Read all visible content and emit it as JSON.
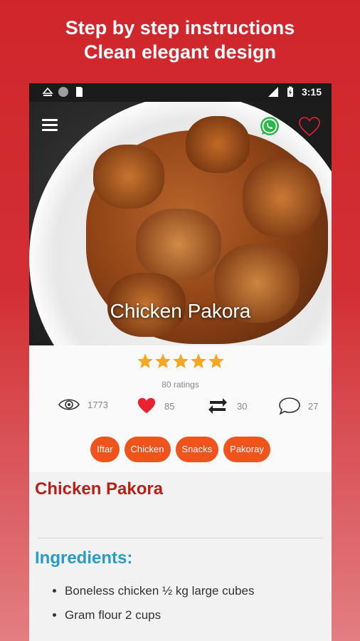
{
  "promo": {
    "line1": "Step by step instructions",
    "line2": "Clean elegant design"
  },
  "statusbar": {
    "time": "3:15",
    "icons": [
      "eject-icon",
      "circle-icon",
      "sd-card-icon",
      "signal-off-icon",
      "battery-icon"
    ]
  },
  "hero": {
    "title": "Chicken Pakora",
    "menu_icon": "hamburger-menu-icon",
    "share_icon": "whatsapp-icon",
    "favorite_icon": "heart-outline-icon"
  },
  "rating": {
    "stars": 5,
    "ratings_text": "80 ratings",
    "star_color": "#f5a623"
  },
  "stats": {
    "views": "1773",
    "likes": "85",
    "shares": "30",
    "comments": "27"
  },
  "tags": [
    "Iftar",
    "Chicken",
    "Snacks",
    "Pakoray"
  ],
  "recipe": {
    "title": "Chicken Pakora",
    "ingredients_heading": "Ingredients:",
    "ingredients": [
      "Boneless chicken ½ kg large cubes",
      "Gram flour 2 cups"
    ]
  },
  "colors": {
    "brand_red": "#d0262b",
    "tag_orange": "#f0531c",
    "title_red": "#b42119",
    "heading_blue": "#2a9bc4",
    "heart_red": "#e8222e"
  }
}
